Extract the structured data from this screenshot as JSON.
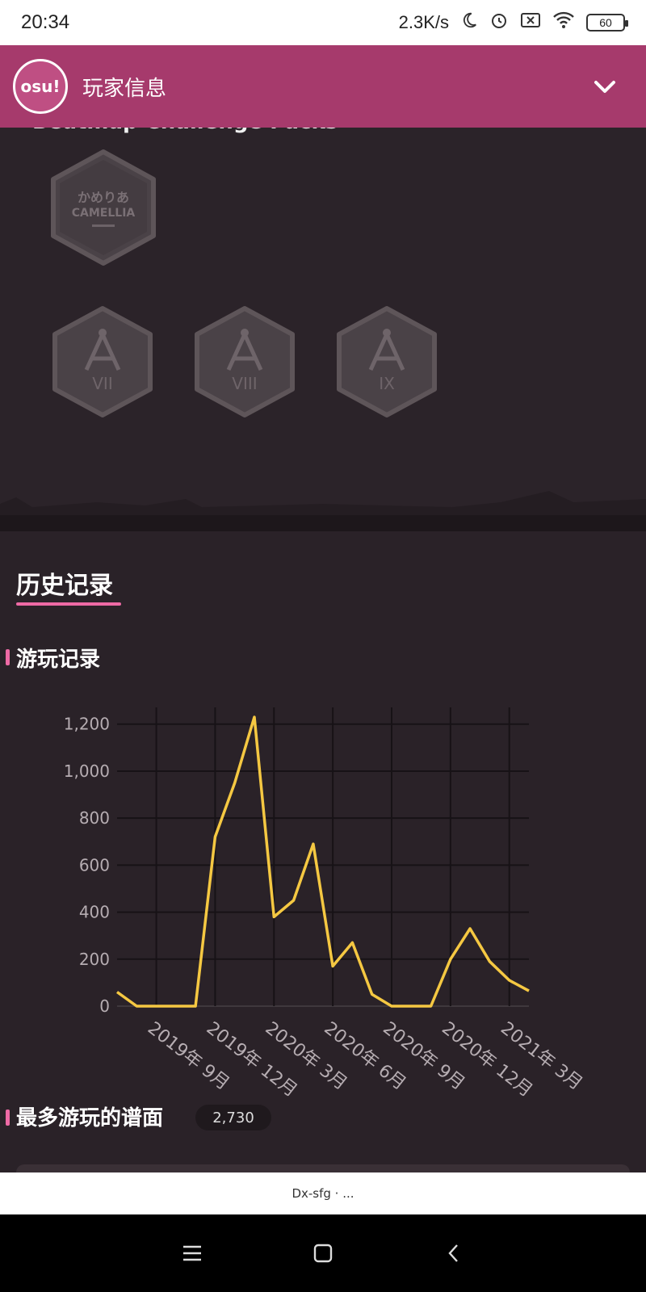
{
  "status_bar": {
    "time": "20:34",
    "network_speed": "2.3K/s",
    "battery": "60",
    "icons": [
      "moon-icon",
      "alarm-icon",
      "sim-off-icon",
      "wifi-icon",
      "battery-icon"
    ]
  },
  "header": {
    "logo_text": "osu!",
    "title": "玩家信息",
    "accent_color": "#a63a6c"
  },
  "packs": {
    "title": "Beatmap Challenge Packs",
    "badges": [
      {
        "name": "camellia-pack",
        "label": ""
      },
      {
        "name": "pack-vii",
        "label": "VII"
      },
      {
        "name": "pack-viii",
        "label": "VIII"
      },
      {
        "name": "pack-ix",
        "label": "IX"
      }
    ]
  },
  "history": {
    "title": "历史记录",
    "play_history_title": "游玩记录",
    "most_played_title": "最多游玩的谱面",
    "most_played_count": "2,730"
  },
  "chart_data": {
    "type": "line",
    "x": [
      "2019-08",
      "2019-09",
      "2019-10",
      "2019-11",
      "2019-12",
      "2020-01",
      "2020-02",
      "2020-03",
      "2020-04",
      "2020-05",
      "2020-06",
      "2020-07",
      "2020-08",
      "2020-09",
      "2020-10",
      "2020-11",
      "2020-12",
      "2021-01",
      "2021-02",
      "2021-03",
      "2021-04"
    ],
    "series": [
      {
        "values": [
          60,
          0,
          0,
          0,
          0,
          720,
          950,
          1230,
          380,
          450,
          690,
          170,
          270,
          50,
          0,
          0,
          0,
          200,
          330,
          190,
          110,
          65
        ]
      }
    ],
    "x_values": [
      "2019-08",
      "2019-09",
      "2019-10",
      "2019-11",
      "2019-12",
      "2020-01",
      "2020-02",
      "2020-03",
      "2020-04",
      "2020-05",
      "2020-06",
      "2020-07",
      "2020-08",
      "2020-09",
      "2020-10",
      "2020-11",
      "2020-12",
      "2021-01",
      "2021-02",
      "2021-03",
      "2021-04",
      "2021-05"
    ],
    "y_ticks": [
      "0",
      "200",
      "400",
      "600",
      "800",
      "1,000",
      "1,200"
    ],
    "x_ticks": [
      "2019年 9月",
      "2019年 12月",
      "2020年 3月",
      "2020年 6月",
      "2020年 9月",
      "2020年 12月",
      "2021年 3月"
    ],
    "ylim": [
      0,
      1230
    ],
    "grid": true,
    "line_color": "#f5c842"
  },
  "bottom": {
    "label": "Dx-sfg · ..."
  }
}
